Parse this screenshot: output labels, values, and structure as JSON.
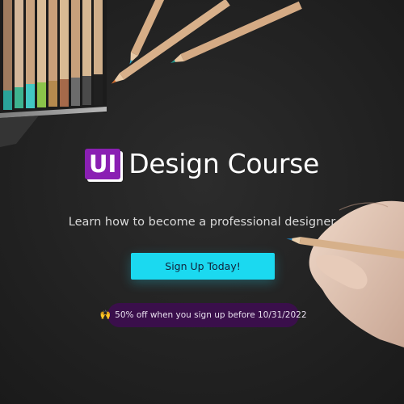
{
  "hero": {
    "brand_badge": "UI",
    "title": "Design Course",
    "tagline": "Learn how to become a professional designer",
    "cta_label": "Sign Up Today!",
    "promo_icon": "🙌",
    "promo_text": "50% off when you sign up before 10/31/2022"
  },
  "colors": {
    "background": "#232323",
    "brand": "#8a1fb3",
    "cta": "#1bd9f0",
    "promo_background": "#3a0f4b"
  },
  "icons": {
    "promo": "raising-hands-icon"
  }
}
